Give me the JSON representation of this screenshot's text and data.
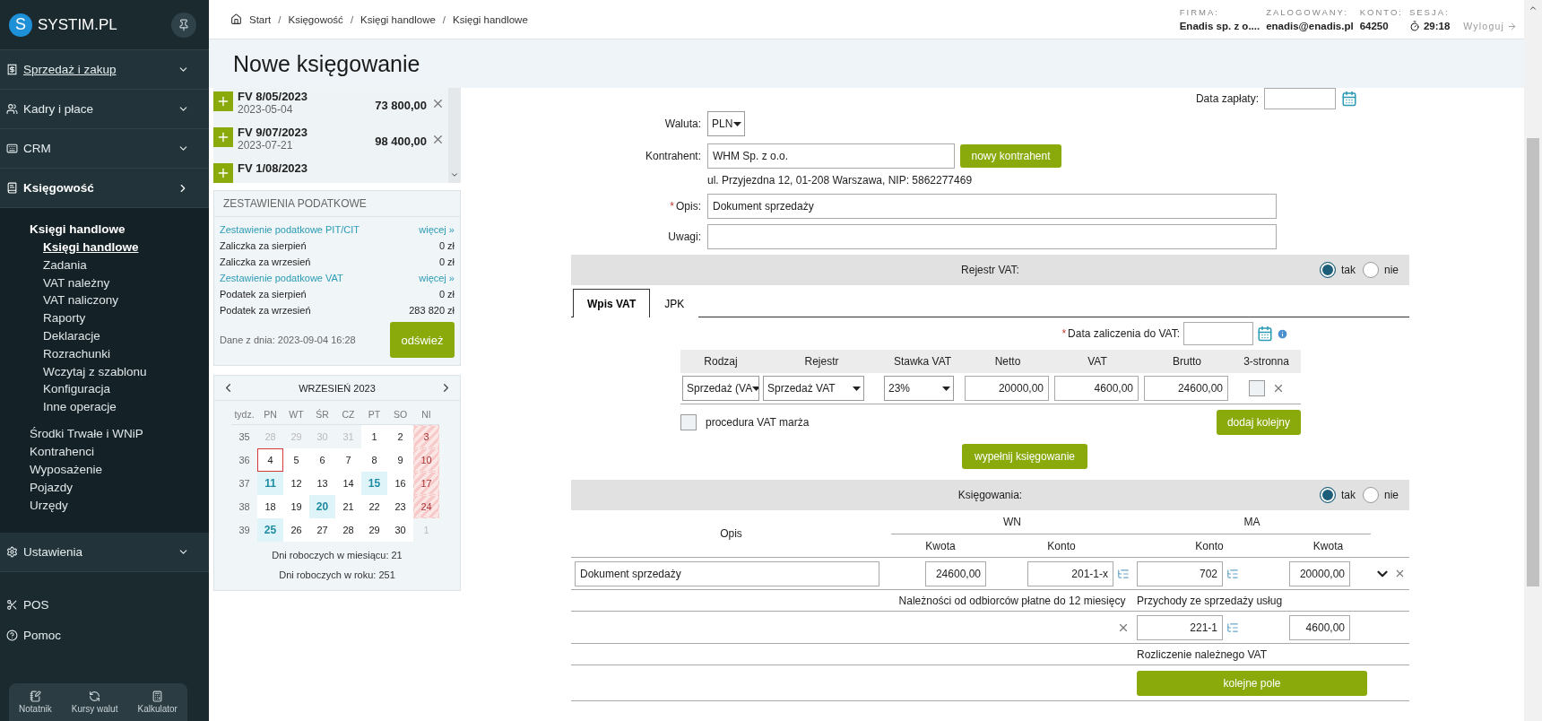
{
  "sidebar": {
    "logo_mark": "S",
    "logo_text": "SYSTIM.PL",
    "sections": [
      {
        "label": "Sprzedaż i zakup",
        "expanded": false,
        "hovered": true
      },
      {
        "label": "Kadry i płace",
        "expanded": false,
        "hovered": false
      },
      {
        "label": "CRM",
        "expanded": false,
        "hovered": false
      },
      {
        "label": "Księgowość",
        "expanded": true,
        "hovered": false,
        "children": [
          {
            "label": "Księgi handlowe",
            "selected": true,
            "children": [
              {
                "label": "Księgi handlowe",
                "selected": true
              },
              {
                "label": "Zadania",
                "selected": false
              },
              {
                "label": "VAT należny",
                "selected": false
              },
              {
                "label": "VAT naliczony",
                "selected": false
              },
              {
                "label": "Raporty",
                "selected": false
              },
              {
                "label": "Deklaracje",
                "selected": false
              },
              {
                "label": "Rozrachunki",
                "selected": false
              },
              {
                "label": "Wczytaj z szablonu",
                "selected": false
              },
              {
                "label": "Konfiguracja",
                "selected": false
              },
              {
                "label": "Inne operacje",
                "selected": false
              }
            ]
          },
          {
            "label": "Środki Trwałe i WNiP",
            "selected": false
          },
          {
            "label": "Kontrahenci",
            "selected": false
          },
          {
            "label": "Wyposażenie",
            "selected": false
          },
          {
            "label": "Pojazdy",
            "selected": false
          },
          {
            "label": "Urzędy",
            "selected": false
          }
        ]
      },
      {
        "label": "Ustawienia",
        "expanded": false,
        "hovered": false
      }
    ],
    "links": [
      "POS",
      "Pomoc"
    ],
    "tools": [
      "Notatnik",
      "Kursy walut",
      "Kalkulator"
    ]
  },
  "header": {
    "breadcrumb": [
      {
        "label": "Start"
      },
      {
        "separator": "/",
        "label": "Księgowość"
      },
      {
        "separator": "/",
        "label": "Księgi handlowe"
      },
      {
        "separator": "/",
        "label": "Księgi handlowe"
      }
    ],
    "info": [
      {
        "label": "FIRMA:",
        "value": "Enadis sp. z o...."
      },
      {
        "label": "ZALOGOWANY:",
        "value": "enadis@enadis.pl"
      },
      {
        "label": "KONTO:",
        "value": "64250"
      },
      {
        "label": "SESJA:",
        "value": "29:18",
        "kind": "timer"
      }
    ],
    "logout": "Wyloguj"
  },
  "title": "Nowe księgowanie",
  "invoices": [
    {
      "number": "FV 8/05/2023",
      "date": "2023-05-04",
      "amount": "73 800,00"
    },
    {
      "number": "FV 9/07/2023",
      "date": "2023-07-21",
      "amount": "98 400,00"
    },
    {
      "number": "FV 1/08/2023"
    }
  ],
  "tax_panel": {
    "title": "ZESTAWIENIA PODATKOWE",
    "rows": [
      {
        "kind": "link",
        "label": "Zestawienie podatkowe PIT/CIT",
        "action": "więcej »"
      },
      {
        "kind": "value",
        "label": "Zaliczka za sierpień",
        "value": "0 zł"
      },
      {
        "kind": "value",
        "label": "Zaliczka za wrzesień",
        "value": "0 zł"
      },
      {
        "kind": "link",
        "label": "Zestawienie podatkowe VAT",
        "action": "więcej »"
      },
      {
        "kind": "value",
        "label": "Podatek za sierpień",
        "value": "0 zł"
      },
      {
        "kind": "value",
        "label": "Podatek za wrzesień",
        "value": "283 820 zł"
      }
    ],
    "data_date": "Dane z dnia: 2023-09-04 16:28",
    "refresh": "odśwież"
  },
  "calendar": {
    "month": "WRZESIEŃ 2023",
    "headers": [
      "tydz.",
      "PN",
      "WT",
      "ŚR",
      "CZ",
      "PT",
      "SO",
      "NI"
    ],
    "weeks": [
      {
        "week": "35",
        "days": [
          {
            "day": "28",
            "kind": "other",
            "today": false,
            "marked": false
          },
          {
            "day": "29",
            "kind": "other",
            "today": false,
            "marked": false
          },
          {
            "day": "30",
            "kind": "other",
            "today": false,
            "marked": false
          },
          {
            "day": "31",
            "kind": "other",
            "today": false,
            "marked": false
          },
          {
            "day": "1",
            "kind": "work",
            "today": false,
            "marked": false
          },
          {
            "day": "2",
            "kind": "work",
            "today": false,
            "marked": false
          },
          {
            "day": "3",
            "kind": "holiday",
            "today": false,
            "marked": false
          }
        ]
      },
      {
        "week": "36",
        "days": [
          {
            "day": "4",
            "kind": "work",
            "today": true,
            "marked": false
          },
          {
            "day": "5",
            "kind": "work",
            "today": false,
            "marked": false
          },
          {
            "day": "6",
            "kind": "work",
            "today": false,
            "marked": false
          },
          {
            "day": "7",
            "kind": "work",
            "today": false,
            "marked": false
          },
          {
            "day": "8",
            "kind": "work",
            "today": false,
            "marked": false
          },
          {
            "day": "9",
            "kind": "work",
            "today": false,
            "marked": false
          },
          {
            "day": "10",
            "kind": "holiday",
            "today": false,
            "marked": false
          }
        ]
      },
      {
        "week": "37",
        "days": [
          {
            "day": "11",
            "kind": "work",
            "today": false,
            "marked": true
          },
          {
            "day": "12",
            "kind": "work",
            "today": false,
            "marked": false
          },
          {
            "day": "13",
            "kind": "work",
            "today": false,
            "marked": false
          },
          {
            "day": "14",
            "kind": "work",
            "today": false,
            "marked": false
          },
          {
            "day": "15",
            "kind": "work",
            "today": false,
            "marked": true
          },
          {
            "day": "16",
            "kind": "work",
            "today": false,
            "marked": false
          },
          {
            "day": "17",
            "kind": "holiday",
            "today": false,
            "marked": false
          }
        ]
      },
      {
        "week": "38",
        "days": [
          {
            "day": "18",
            "kind": "work",
            "today": false,
            "marked": false
          },
          {
            "day": "19",
            "kind": "work",
            "today": false,
            "marked": false
          },
          {
            "day": "20",
            "kind": "work",
            "today": false,
            "marked": true
          },
          {
            "day": "21",
            "kind": "work",
            "today": false,
            "marked": false
          },
          {
            "day": "22",
            "kind": "work",
            "today": false,
            "marked": false
          },
          {
            "day": "23",
            "kind": "work",
            "today": false,
            "marked": false
          },
          {
            "day": "24",
            "kind": "holiday",
            "today": false,
            "marked": false
          }
        ]
      },
      {
        "week": "39",
        "days": [
          {
            "day": "25",
            "kind": "work",
            "today": false,
            "marked": true
          },
          {
            "day": "26",
            "kind": "work",
            "today": false,
            "marked": false
          },
          {
            "day": "27",
            "kind": "work",
            "today": false,
            "marked": false
          },
          {
            "day": "28",
            "kind": "work",
            "today": false,
            "marked": false
          },
          {
            "day": "29",
            "kind": "work",
            "today": false,
            "marked": false
          },
          {
            "day": "30",
            "kind": "work",
            "today": false,
            "marked": false
          },
          {
            "day": "1",
            "kind": "other",
            "today": false,
            "marked": false
          }
        ]
      }
    ],
    "footer": [
      "Dni roboczych w miesiącu: 21",
      "Dni roboczych w roku: 251"
    ]
  },
  "form": {
    "payment_date_label": "Data zapłaty:",
    "currency": {
      "label": "Waluta:",
      "value": "PLN"
    },
    "contractor": {
      "label": "Kontrahent:",
      "value": "WHM Sp. z o.o.",
      "button": "nowy kontrahent",
      "address": "ul. Przyjezdna 12, 01-208 Warszawa, NIP: 5862277469"
    },
    "description": {
      "label": "Opis:",
      "required_mark": "*",
      "value": "Dokument sprzedaży"
    },
    "notes": {
      "label": "Uwagi:"
    }
  },
  "vat": {
    "title": "Rejestr VAT:",
    "options": [
      {
        "label": "tak",
        "selected": true
      },
      {
        "label": "nie",
        "selected": false
      }
    ],
    "tabs": [
      {
        "label": "Wpis VAT",
        "selected": true
      },
      {
        "label": "JPK",
        "selected": false
      }
    ],
    "date_label": "Data zaliczenia do VAT:",
    "date_required_mark": "*",
    "columns": [
      "Rodzaj",
      "Rejestr",
      "Stawka VAT",
      "Netto",
      "VAT",
      "Brutto",
      "3-stronna"
    ],
    "row": {
      "kind": "Sprzedaż (VA",
      "register": "Sprzedaż VAT",
      "rate": "23%",
      "net": "20000,00",
      "vat": "4600,00",
      "gross": "24600,00",
      "three_way": false
    },
    "margin": {
      "label": "procedura VAT marża",
      "checked": false
    },
    "add_button": "dodaj kolejny",
    "fill_button": "wypełnij księgowanie"
  },
  "bookings": {
    "title": "Księgowania:",
    "options": [
      {
        "label": "tak",
        "selected": true
      },
      {
        "label": "nie",
        "selected": false
      }
    ],
    "columns": {
      "opis": "Opis",
      "wn": "WN",
      "ma": "MA",
      "wn_amount": "Kwota",
      "wn_account": "Konto",
      "ma_account": "Konto",
      "ma_amount": "Kwota"
    },
    "rows": [
      {
        "description": "Dokument sprzedaży",
        "wn_amount": "24600,00",
        "wn_account": "201-1-x",
        "ma_account": "702",
        "ma_amount": "20000,00",
        "wn_name": "Należności od odbiorców płatne do 12 miesięcy",
        "ma_name": "Przychody ze sprzedaży usług"
      },
      {
        "ma_account": "221-1",
        "ma_amount": "4600,00",
        "ma_name": "Rozliczenie należnego VAT"
      }
    ],
    "next_button": "kolejne pole"
  }
}
